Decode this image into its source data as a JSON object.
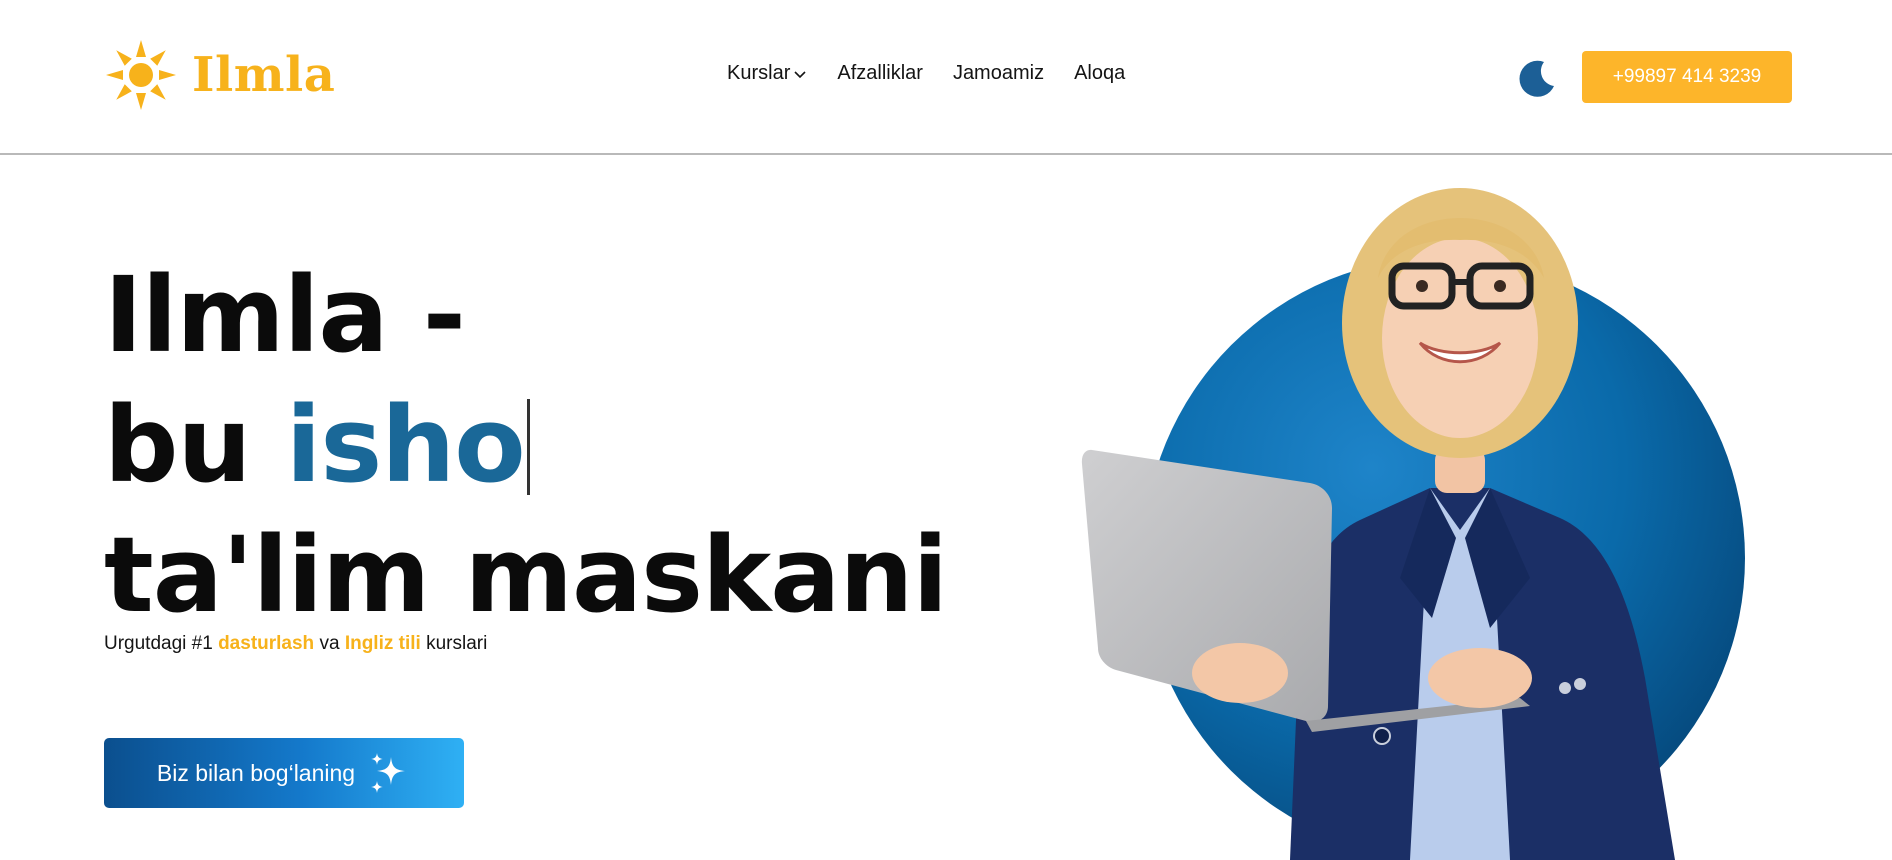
{
  "header": {
    "logo_text": "Ilmla",
    "nav": [
      {
        "label": "Kurslar",
        "has_dropdown": true
      },
      {
        "label": "Afzalliklar",
        "has_dropdown": false
      },
      {
        "label": "Jamoamiz",
        "has_dropdown": false
      },
      {
        "label": "Aloqa",
        "has_dropdown": false
      }
    ],
    "theme_icon": "moon-icon",
    "phone": "+99897 414 3239"
  },
  "hero": {
    "line1": "Ilmla -",
    "line2_prefix": "bu",
    "line2_typed": "isho",
    "line3": "ta'lim maskani",
    "subtitle": {
      "prefix": "Urgutdagi #1",
      "highlight1": "dasturlash",
      "middle": "va",
      "highlight2": "Ingliz tili",
      "suffix": "kurslari"
    },
    "cta_label": "Biz bilan bog‘laning",
    "cta_icon": "sparkle-icon"
  },
  "colors": {
    "brand_yellow": "#F7B21B",
    "button_yellow": "#FDB52A",
    "accent_blue": "#1A6898",
    "circle_blue": "#0a6bad"
  }
}
